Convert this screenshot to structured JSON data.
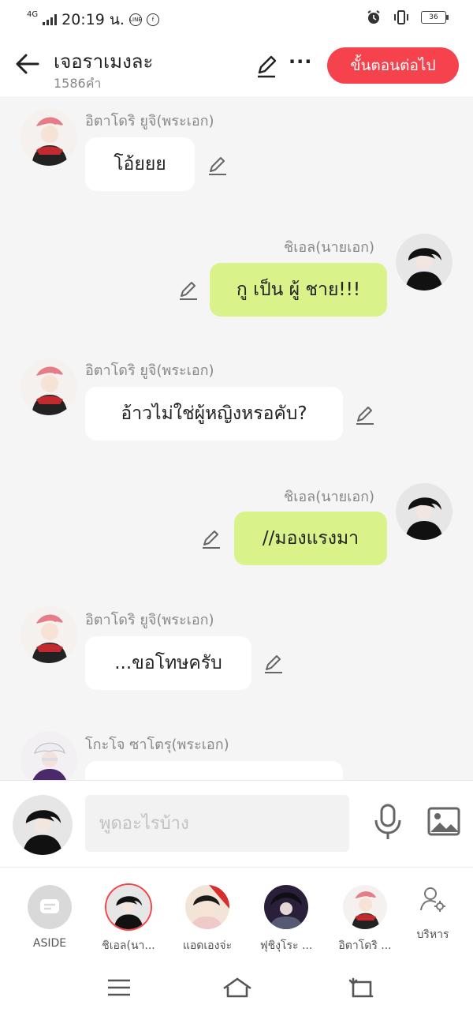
{
  "status": {
    "network": "4G",
    "time": "20:19 น.",
    "battery": "36",
    "app_badge_1": "LINE",
    "app_badge_2": "f"
  },
  "header": {
    "title": "เจอราเมงละ",
    "word_count": "1586คำ",
    "next_label": "ขั้นตอนต่อไป",
    "more_label": "···"
  },
  "messages": [
    {
      "side": "left",
      "name": "อิตาโดริ ยูจิ(พระเอก)",
      "text": "โอ้ยยย",
      "avatar": "yuji"
    },
    {
      "side": "right",
      "name": "ชิเอล(นายเอก)",
      "text": "กู เป็น ผู้ ชาย!!!",
      "avatar": "ciel"
    },
    {
      "side": "left",
      "name": "อิตาโดริ ยูจิ(พระเอก)",
      "text": "อ้าวไม่ใช่ผู้หญิงหรอคับ?",
      "avatar": "yuji"
    },
    {
      "side": "right",
      "name": "ชิเอล(นายเอก)",
      "text": "//มองแรงมา",
      "avatar": "ciel"
    },
    {
      "side": "left",
      "name": "อิตาโดริ ยูจิ(พระเอก)",
      "text": "...ขอโทษครับ",
      "avatar": "yuji"
    },
    {
      "side": "left",
      "name": "โกะโจ ซาโตรุ(พระเอก)",
      "text": "",
      "avatar": "gojo"
    }
  ],
  "composer": {
    "placeholder": "พูดอะไรบ้าง"
  },
  "characters": [
    {
      "label": "ASIDE",
      "kind": "aside"
    },
    {
      "label": "ชิเอล(นา...",
      "kind": "ciel",
      "selected": true
    },
    {
      "label": "แอดเองจ่ะ",
      "kind": "admin"
    },
    {
      "label": "ฟุชิงุโระ ...",
      "kind": "fushiguro"
    },
    {
      "label": "อิตาโดริ ...",
      "kind": "yuji"
    },
    {
      "label": "บริหาร",
      "kind": "manage"
    }
  ],
  "colors": {
    "accent": "#f5424c",
    "right_bubble": "#d9f28a",
    "chat_bg": "#f5f5f5"
  }
}
